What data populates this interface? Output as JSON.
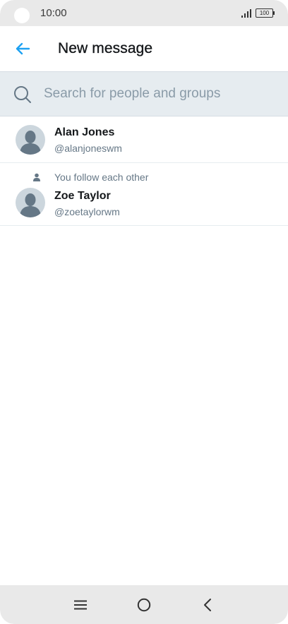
{
  "status_bar": {
    "time": "10:00",
    "battery": "100"
  },
  "header": {
    "title": "New message"
  },
  "search": {
    "placeholder": "Search for people and groups",
    "value": ""
  },
  "contacts": [
    {
      "name": "Alan Jones",
      "handle": "@alanjoneswm",
      "context": ""
    },
    {
      "name": "Zoe Taylor",
      "handle": "@zoetaylorwm",
      "context": "You follow each other"
    }
  ],
  "colors": {
    "accent": "#1da1f2",
    "text_primary": "#14171a",
    "text_secondary": "#657786",
    "search_bg": "#e6ecf0",
    "avatar_bg": "#ccd6dd"
  },
  "icons": {
    "back": "arrow-left-icon",
    "search": "search-icon",
    "avatar": "default-avatar-icon",
    "follow": "person-icon",
    "nav_menu": "menu-icon",
    "nav_home": "home-circle-icon",
    "nav_back": "chevron-left-icon"
  }
}
